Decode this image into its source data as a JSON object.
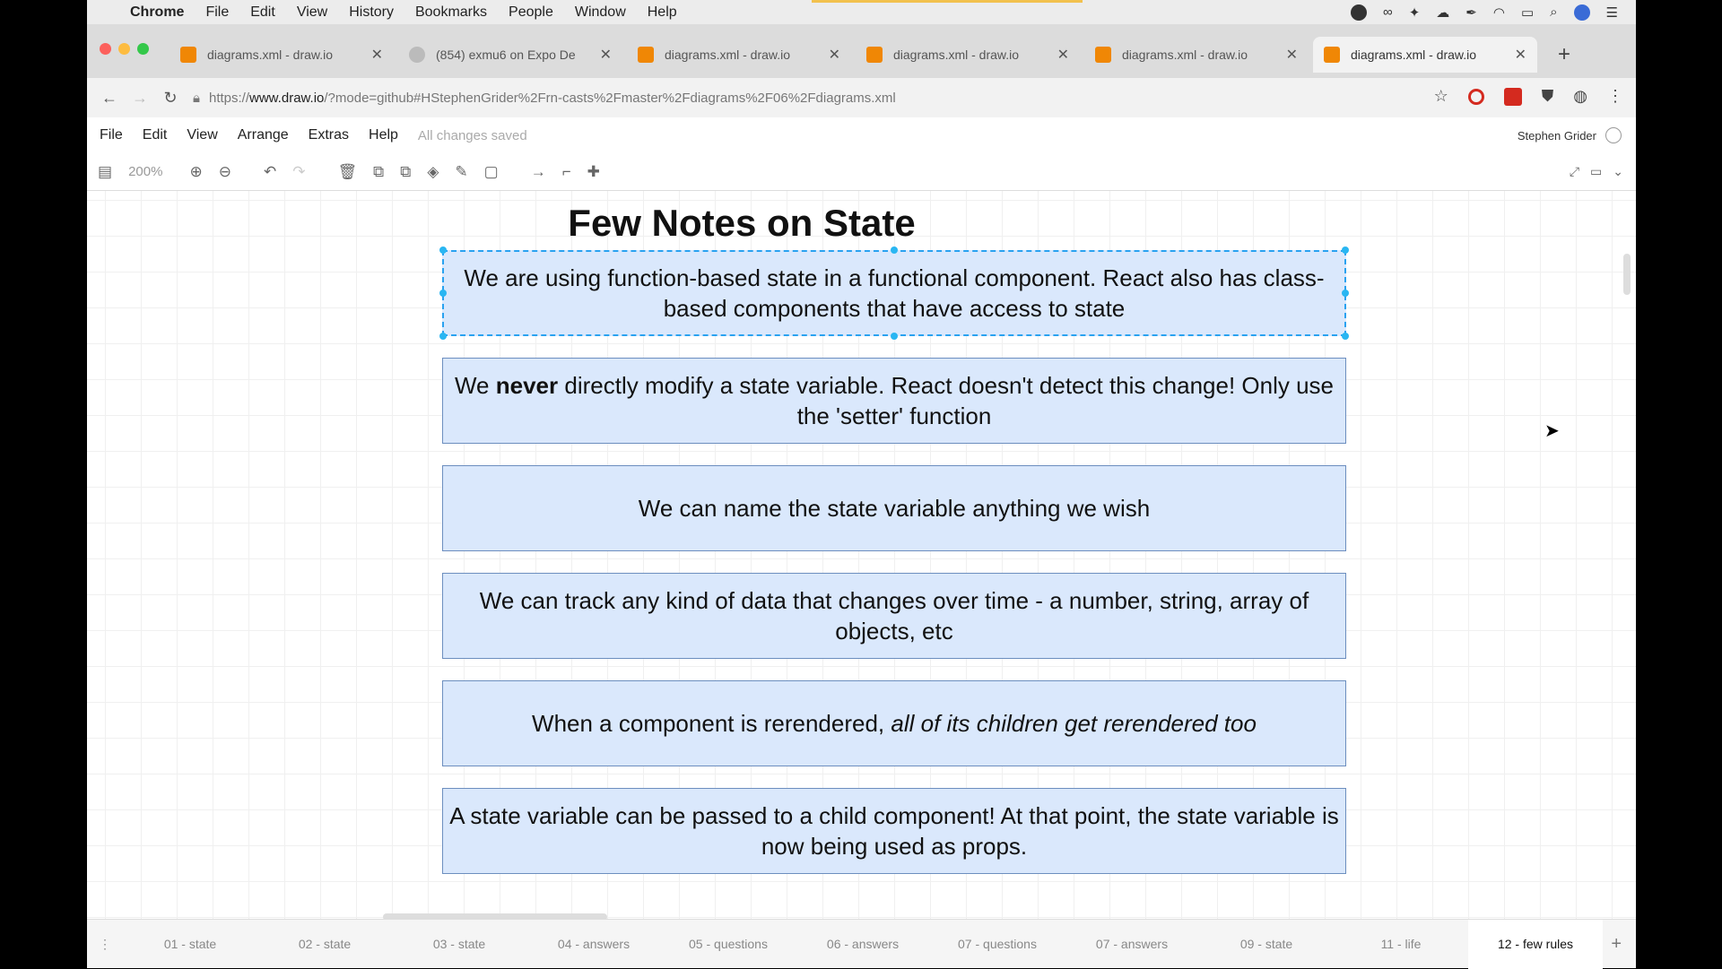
{
  "menubar": {
    "app": "Chrome",
    "items": [
      "File",
      "Edit",
      "View",
      "History",
      "Bookmarks",
      "People",
      "Window",
      "Help"
    ]
  },
  "tabs": [
    {
      "title": "diagrams.xml - draw.io"
    },
    {
      "title": "(854) exmu6 on Expo De"
    },
    {
      "title": "diagrams.xml - draw.io"
    },
    {
      "title": "diagrams.xml - draw.io"
    },
    {
      "title": "diagrams.xml - draw.io"
    },
    {
      "title": "diagrams.xml - draw.io"
    }
  ],
  "address": {
    "scheme": "https://",
    "host": "www.draw.io",
    "path": "/?mode=github#HStephenGrider%2Frn-casts%2Fmaster%2Fdiagrams%2F06%2Fdiagrams.xml"
  },
  "appmenu": {
    "items": [
      "File",
      "Edit",
      "View",
      "Arrange",
      "Extras",
      "Help"
    ],
    "status": "All changes saved",
    "user": "Stephen Grider"
  },
  "drawtools": {
    "zoom": "200%"
  },
  "canvas": {
    "title": "Few Notes on State",
    "notes": [
      {
        "parts": [
          {
            "text": "We are using function-based state in a functional component.  React also has class-based components that have access to state",
            "style": "normal"
          }
        ]
      },
      {
        "parts": [
          {
            "text": "We ",
            "style": "normal"
          },
          {
            "text": "never",
            "style": "bold"
          },
          {
            "text": " directly modify a state variable.  React doesn't detect this change!  Only use the 'setter' function",
            "style": "normal"
          }
        ]
      },
      {
        "parts": [
          {
            "text": "We can name the state variable anything we wish",
            "style": "normal"
          }
        ]
      },
      {
        "parts": [
          {
            "text": "We can track any kind of data that changes over time - a number, string, array of objects, etc",
            "style": "normal"
          }
        ]
      },
      {
        "parts": [
          {
            "text": "When a component is rerendered, ",
            "style": "normal"
          },
          {
            "text": "all of its children get rerendered too",
            "style": "italic"
          }
        ]
      },
      {
        "parts": [
          {
            "text": "A state variable can be passed to a child component!  At that point, the state variable is now being used as props.",
            "style": "normal"
          }
        ]
      }
    ]
  },
  "pages": [
    "01 - state",
    "02 - state",
    "03 - state",
    "04 - answers",
    "05 - questions",
    "06 - answers",
    "07 - questions",
    "07 - answers",
    "09 - state",
    "11 - life",
    "12 - few rules"
  ],
  "active_page": "12 - few rules"
}
